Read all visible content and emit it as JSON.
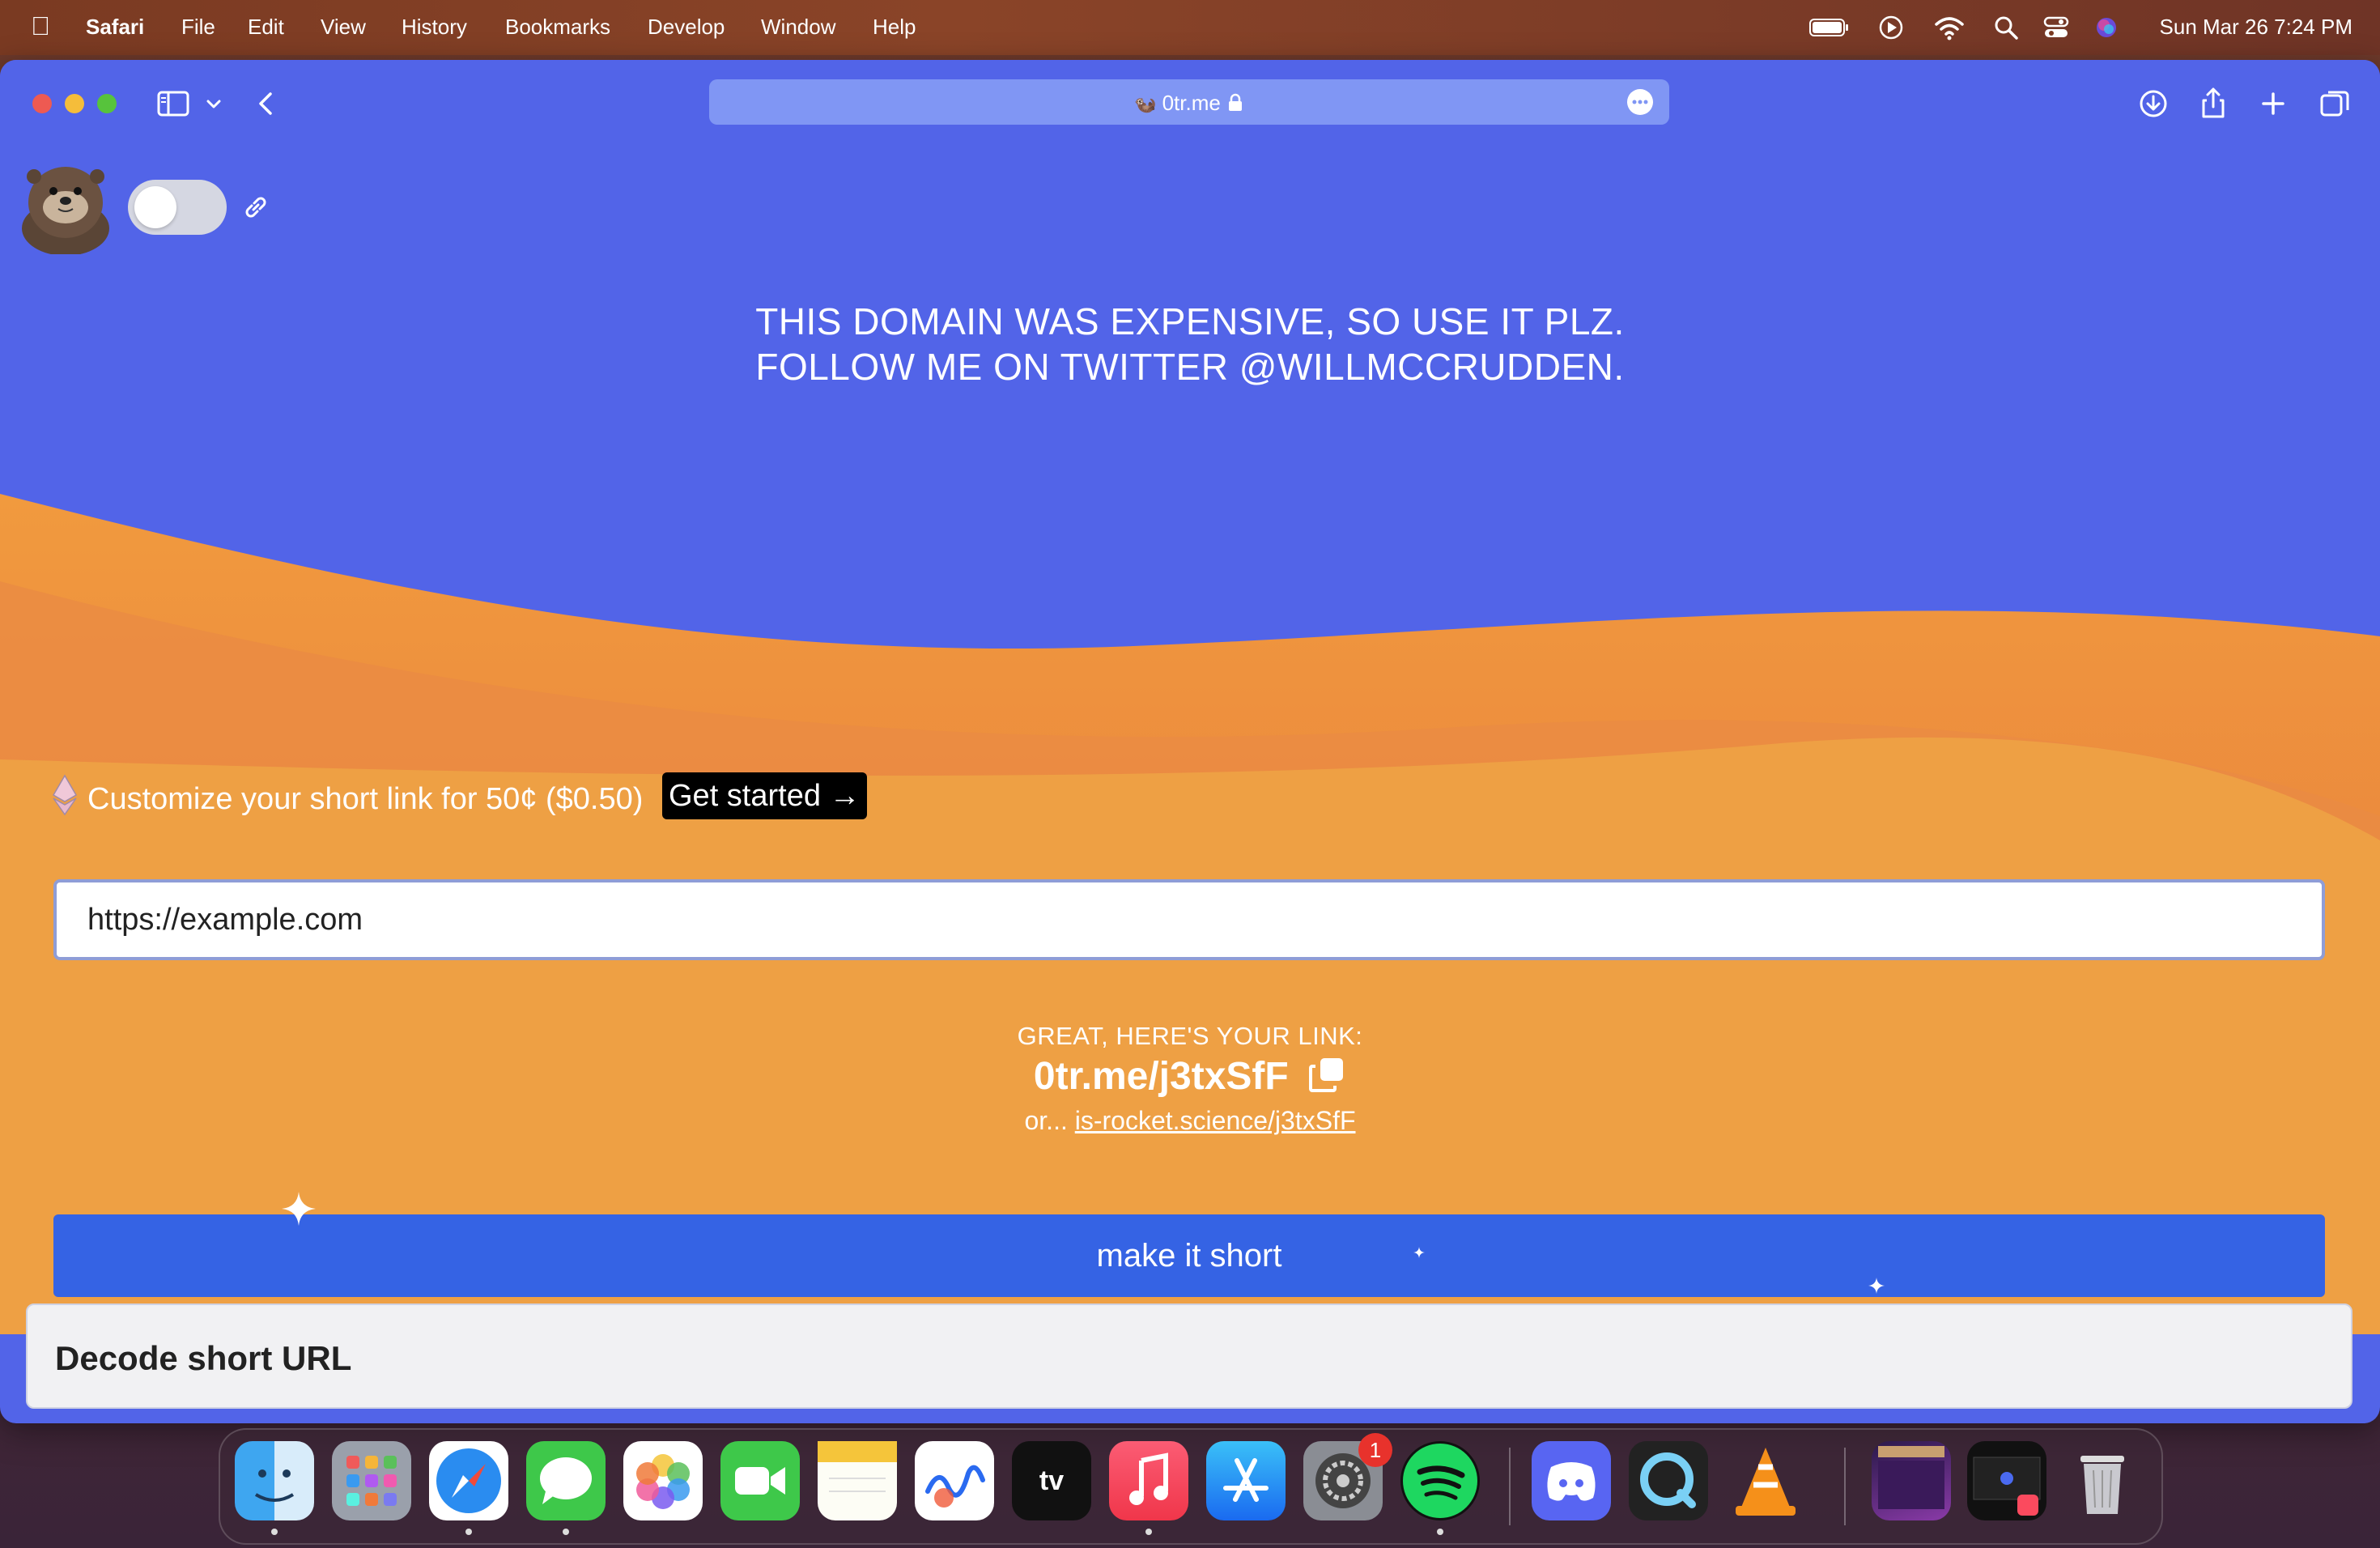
{
  "menubar": {
    "app": "Safari",
    "items": [
      "File",
      "Edit",
      "View",
      "History",
      "Bookmarks",
      "Develop",
      "Window",
      "Help"
    ],
    "datetime": "Sun Mar 26  7:24 PM",
    "status_icons": [
      "battery-icon",
      "play-icon",
      "wifi-icon",
      "spotlight-icon",
      "control-center-icon",
      "siri-icon"
    ]
  },
  "browser": {
    "url": "0tr.me",
    "toolbar_icons": [
      "sidebar-icon",
      "chevron-down-icon",
      "back-icon",
      "downloads-icon",
      "share-icon",
      "new-tab-icon",
      "tabs-overview-icon"
    ]
  },
  "page": {
    "headline_line1": "THIS DOMAIN WAS EXPENSIVE, SO USE IT PLZ.",
    "headline_line2": "FOLLOW ME ON TWITTER @WILLMCCRUDDEN.",
    "promo_text": "Customize your short link for 50¢ ($0.50)",
    "get_started": "Get started →",
    "url_input_value": "https://example.com",
    "result_label": "GREAT, HERE'S YOUR LINK:",
    "short_link": "0tr.me/j3txSfF",
    "alt_prefix": "or...",
    "alt_link": "is-rocket.science/j3txSfF",
    "make_button": "make it short",
    "decode_title": "Decode short URL",
    "toggle_on": false
  },
  "dock": {
    "apps": [
      "Finder",
      "Launchpad",
      "Safari",
      "Messages",
      "Photos",
      "FaceTime",
      "Notes",
      "Freeform",
      "Apple TV",
      "Music",
      "App Store",
      "System Settings",
      "Spotify",
      "Discord",
      "QuickTime Player",
      "VLC",
      "Recent 1",
      "Recent 2",
      "Trash"
    ],
    "settings_badge": "1"
  },
  "colors": {
    "page_blue": "#5264e8",
    "sand_orange": "#eea044",
    "button_blue": "#3563e4"
  }
}
